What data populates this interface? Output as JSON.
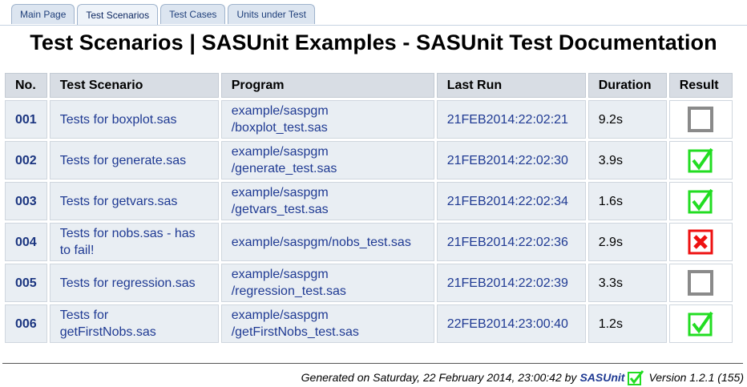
{
  "tabs": [
    {
      "label": "Main Page",
      "active": false
    },
    {
      "label": "Test Scenarios",
      "active": true
    },
    {
      "label": "Test Cases",
      "active": false
    },
    {
      "label": "Units under Test",
      "active": false
    }
  ],
  "page_title": "Test Scenarios | SASUnit Examples - SASUnit Test Documentation",
  "table": {
    "headers": [
      "No.",
      "Test Scenario",
      "Program",
      "Last Run",
      "Duration",
      "Result"
    ],
    "rows": [
      {
        "no": "001",
        "scenario": [
          "Tests for boxplot.sas"
        ],
        "program": [
          "example/saspgm",
          "/boxplot_test.sas"
        ],
        "last_run": "21FEB2014:22:02:21",
        "duration": "9.2s",
        "result": "empty-box-icon"
      },
      {
        "no": "002",
        "scenario": [
          "Tests for generate.sas"
        ],
        "program": [
          "example/saspgm",
          "/generate_test.sas"
        ],
        "last_run": "21FEB2014:22:02:30",
        "duration": "3.9s",
        "result": "green-check-icon"
      },
      {
        "no": "003",
        "scenario": [
          "Tests for getvars.sas"
        ],
        "program": [
          "example/saspgm",
          "/getvars_test.sas"
        ],
        "last_run": "21FEB2014:22:02:34",
        "duration": "1.6s",
        "result": "green-check-icon"
      },
      {
        "no": "004",
        "scenario": [
          "Tests for nobs.sas - has",
          "to fail!"
        ],
        "program": [
          "example/saspgm/nobs_test.sas"
        ],
        "last_run": "21FEB2014:22:02:36",
        "duration": "2.9s",
        "result": "red-x-icon"
      },
      {
        "no": "005",
        "scenario": [
          "Tests for regression.sas"
        ],
        "program": [
          "example/saspgm",
          "/regression_test.sas"
        ],
        "last_run": "21FEB2014:22:02:39",
        "duration": "3.3s",
        "result": "empty-box-icon"
      },
      {
        "no": "006",
        "scenario": [
          "Tests for",
          "getFirstNobs.sas"
        ],
        "program": [
          "example/saspgm",
          "/getFirstNobs_test.sas"
        ],
        "last_run": "22FEB2014:23:00:40",
        "duration": "1.2s",
        "result": "green-check-icon"
      }
    ]
  },
  "footer": {
    "generated": "Generated on Saturday, 22 February 2014, 23:00:42 by",
    "brand": "SASUnit",
    "version": "Version 1.2.1 (155)"
  },
  "colors": {
    "success": "#22dd22",
    "failure": "#ee1111",
    "neutral": "#8a8a8a",
    "link": "#1f3a93"
  }
}
